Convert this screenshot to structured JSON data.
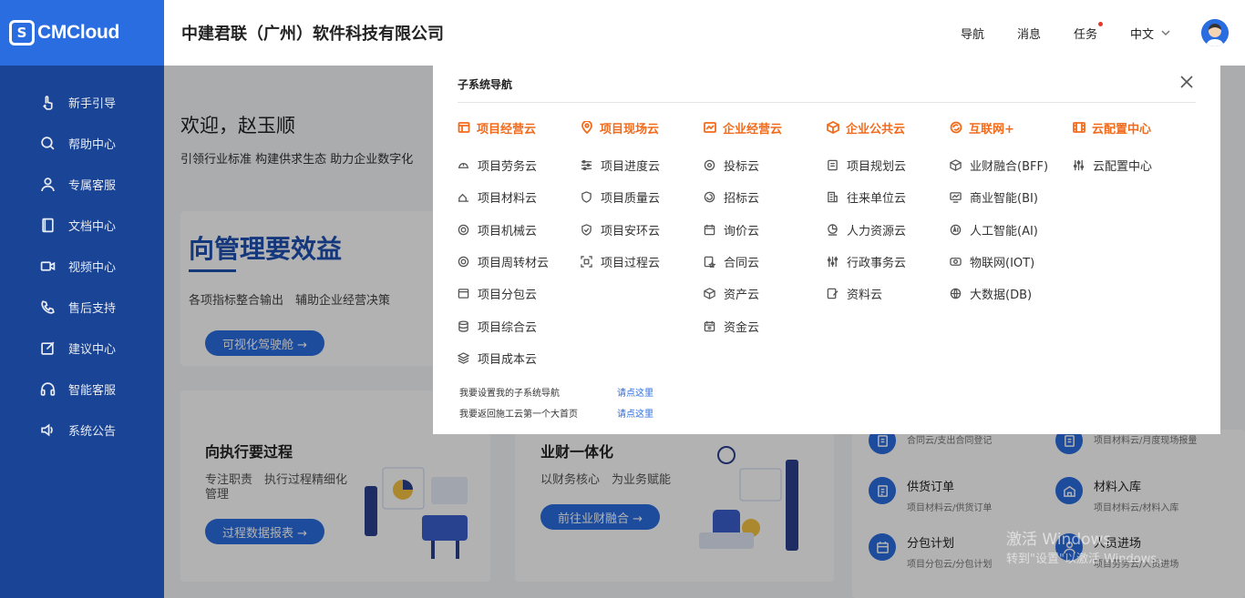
{
  "brand": {
    "logo_text": "CMCloud",
    "logo_mark": "S"
  },
  "sidebar": {
    "items": [
      {
        "label": "新手引导",
        "icon": "hand-pointer-icon"
      },
      {
        "label": "帮助中心",
        "icon": "search-icon"
      },
      {
        "label": "专属客服",
        "icon": "user-icon"
      },
      {
        "label": "文档中心",
        "icon": "book-icon"
      },
      {
        "label": "视频中心",
        "icon": "video-icon"
      },
      {
        "label": "售后支持",
        "icon": "phone-icon"
      },
      {
        "label": "建议中心",
        "icon": "edit-icon"
      },
      {
        "label": "智能客服",
        "icon": "headset-icon"
      },
      {
        "label": "系统公告",
        "icon": "speaker-icon"
      }
    ]
  },
  "header": {
    "company": "中建君联（广州）软件科技有限公司",
    "nav": "导航",
    "messages": "消息",
    "tasks": "任务",
    "language": "中文"
  },
  "main": {
    "welcome": "欢迎，赵玉顺",
    "tagline": "引领行业标准 构建供求生态 助力企业数字化",
    "card1": {
      "title": "向管理要效益",
      "subtitle": "各项指标整合输出　辅助企业经营决策",
      "button": "可视化驾驶舱 →"
    },
    "card2": {
      "title": "向执行要过程",
      "subtitle": "专注职责　执行过程精细化管理",
      "button": "过程数据报表 →"
    },
    "card3": {
      "title": "业财一体化",
      "subtitle": "以财务核心　为业务赋能",
      "button": "前往业财融合 →"
    },
    "quick_items": [
      {
        "name": "",
        "path": "合同云/支出合同登记"
      },
      {
        "name": "",
        "path": "项目材料云/月度现场报量"
      },
      {
        "name": "供货订单",
        "path": "项目材料云/供货订单"
      },
      {
        "name": "材料入库",
        "path": "项目材料云/材料入库"
      },
      {
        "name": "分包计划",
        "path": "项目分包云/分包计划"
      },
      {
        "name": "人员进场",
        "path": "项目劳务云/人员进场"
      }
    ]
  },
  "modal": {
    "title": "子系统导航",
    "columns": [
      {
        "head": "项目经营云",
        "head_icon": "window-icon",
        "items": [
          "项目劳务云",
          "项目材料云",
          "项目机械云",
          "项目周转材云",
          "项目分包云",
          "项目综合云",
          "项目成本云"
        ]
      },
      {
        "head": "项目现场云",
        "head_icon": "location-icon",
        "items": [
          "项目进度云",
          "项目质量云",
          "项目安环云",
          "项目过程云"
        ]
      },
      {
        "head": "企业经营云",
        "head_icon": "chart-icon",
        "items": [
          "投标云",
          "招标云",
          "询价云",
          "合同云",
          "资产云",
          "资金云"
        ]
      },
      {
        "head": "企业公共云",
        "head_icon": "cube-icon",
        "items": [
          "项目规划云",
          "往来单位云",
          "人力资源云",
          "行政事务云",
          "资料云"
        ]
      },
      {
        "head": "互联网+",
        "head_icon": "refresh-icon",
        "items": [
          "业财融合(BFF)",
          "商业智能(BI)",
          "人工智能(AI)",
          "物联网(IOT)",
          "大数据(DB)"
        ]
      },
      {
        "head": "云配置中心",
        "head_icon": "film-icon",
        "items": [
          "云配置中心"
        ]
      }
    ],
    "footer": [
      {
        "label": "我要设置我的子系统导航",
        "link": "请点这里"
      },
      {
        "label": "我要返回施工云第一个大首页",
        "link": "请点这里"
      }
    ]
  },
  "watermark": {
    "line1": "激活 Windows",
    "line2": "转到\"设置\"以激活 Windows。"
  },
  "colors": {
    "sidebar": "#1a4495",
    "logo_bg": "#2a6de0",
    "accent": "#f26b1d",
    "primary": "#2a6de0"
  }
}
